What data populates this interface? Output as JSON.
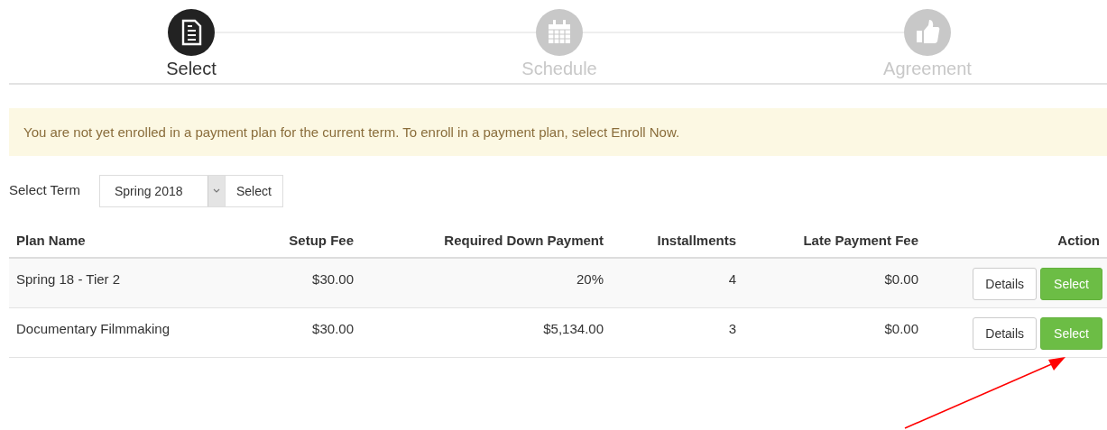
{
  "steps": [
    {
      "label": "Select",
      "selected": true
    },
    {
      "label": "Schedule",
      "selected": false
    },
    {
      "label": "Agreement",
      "selected": false
    }
  ],
  "alert": "You are not yet enrolled in a payment plan for the current term. To enroll in a payment plan, select Enroll Now.",
  "term": {
    "label": "Select Term",
    "value": "Spring 2018",
    "button": "Select"
  },
  "table": {
    "columns": [
      "Plan Name",
      "Setup Fee",
      "Required Down Payment",
      "Installments",
      "Late Payment Fee",
      "Action"
    ],
    "rows": [
      {
        "cells": [
          "Spring 18 - Tier 2",
          "$30.00",
          "20%",
          "4",
          "$0.00"
        ],
        "buttons": [
          "Details",
          "Select"
        ]
      },
      {
        "cells": [
          "Documentary Filmmaking",
          "$30.00",
          "$5,134.00",
          "3",
          "$0.00"
        ],
        "buttons": [
          "Details",
          "Select"
        ]
      }
    ]
  },
  "annotation": {
    "kind": "arrow"
  }
}
